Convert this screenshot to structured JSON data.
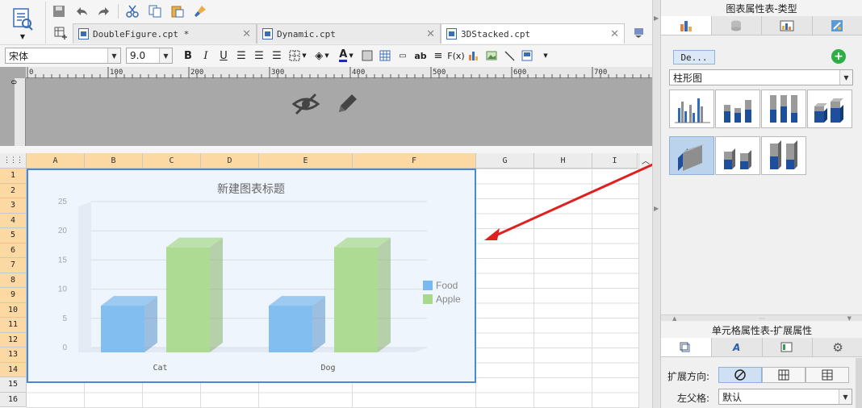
{
  "tabs": [
    {
      "label": "DoubleFigure.cpt *",
      "active": false
    },
    {
      "label": "Dynamic.cpt",
      "active": false
    },
    {
      "label": "3DStacked.cpt",
      "active": true
    }
  ],
  "format_bar": {
    "font_name": "宋体",
    "font_size": "9.0"
  },
  "ruler": {
    "ticks": [
      "0",
      "100",
      "200",
      "300",
      "400",
      "500",
      "600",
      "700"
    ]
  },
  "sheet": {
    "columns": [
      "A",
      "B",
      "C",
      "D",
      "E",
      "F",
      "G",
      "H",
      "I"
    ],
    "rows": [
      "1",
      "2",
      "3",
      "4",
      "5",
      "6",
      "7",
      "8",
      "9",
      "10",
      "11",
      "12",
      "13",
      "14",
      "15",
      "16"
    ]
  },
  "chart_data": {
    "type": "bar",
    "title": "新建图表标题",
    "categories": [
      "Cat",
      "Dog"
    ],
    "series": [
      {
        "name": "Food",
        "values": [
          8,
          8
        ],
        "color": "#7ab8f0"
      },
      {
        "name": "Apple",
        "values": [
          18,
          18
        ],
        "color": "#a8d88a"
      }
    ],
    "ylim": [
      0,
      25
    ],
    "yticks": [
      "0",
      "5",
      "10",
      "15",
      "20",
      "25"
    ],
    "legend": "right",
    "grid": true
  },
  "chart_props": {
    "title": "图表属性表-类型",
    "template_button": "De...",
    "chart_type": "柱形图"
  },
  "cell_props": {
    "title": "单元格属性表-扩展属性",
    "expand_label": "扩展方向:",
    "parent_label": "左父格:",
    "parent_value": "默认"
  }
}
